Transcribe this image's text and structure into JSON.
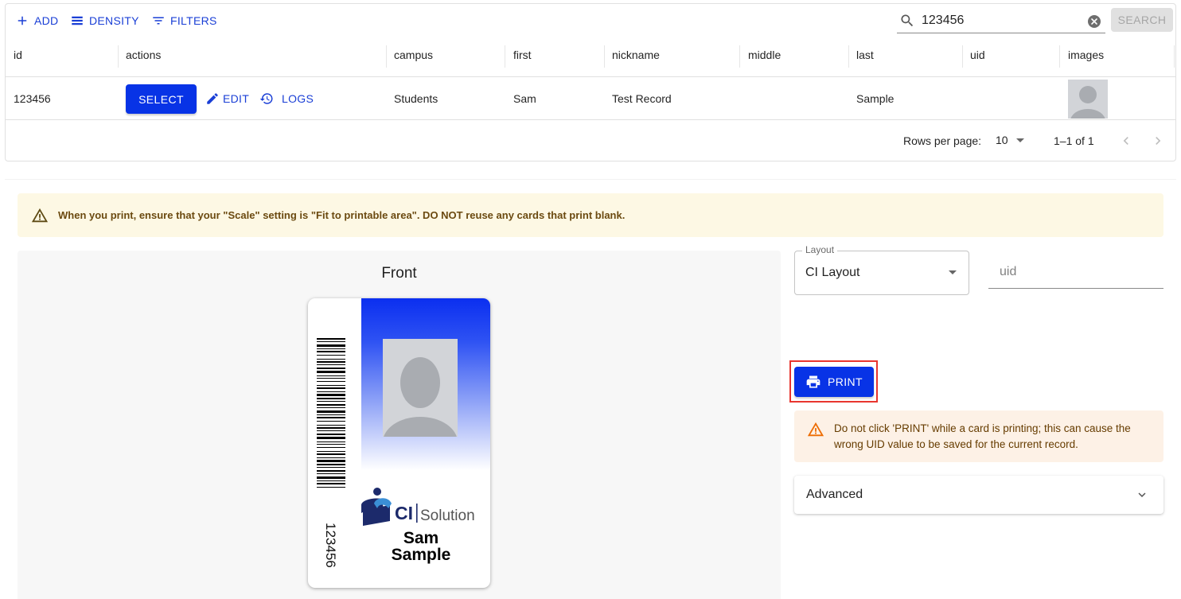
{
  "toolbar": {
    "add_label": "ADD",
    "density_label": "DENSITY",
    "filters_label": "FILTERS",
    "search_value": "123456",
    "search_button_label": "SEARCH"
  },
  "grid": {
    "columns": [
      "id",
      "actions",
      "campus",
      "first",
      "nickname",
      "middle",
      "last",
      "uid",
      "images"
    ],
    "rows": [
      {
        "id": "123456",
        "select_label": "SELECT",
        "edit_label": "EDIT",
        "logs_label": "LOGS",
        "campus": "Students",
        "first": "Sam",
        "nickname": "Test Record",
        "middle": "",
        "last": "Sample",
        "uid": ""
      }
    ],
    "pagination": {
      "rows_per_page_label": "Rows per page:",
      "rows_per_page_value": "10",
      "range_label": "1–1 of 1"
    }
  },
  "print_panel": {
    "info_alert": "When you print, ensure that your \"Scale\" setting is \"Fit to printable area\". DO NOT reuse any cards that print blank.",
    "preview_title": "Front",
    "card": {
      "id_text": "123456",
      "logo_text": "CI Solutions",
      "name_first": "Sam",
      "name_last": "Sample"
    },
    "layout_label": "Layout",
    "layout_value": "CI Layout",
    "uid_placeholder": "uid",
    "print_label": "PRINT",
    "warning_alert": "Do not click 'PRINT' while a card is printing; this can cause the wrong UID value to be saved for the current record.",
    "advanced_label": "Advanced"
  },
  "colors": {
    "primary": "#0833e6",
    "link": "#1a3fd6",
    "info_bg": "#fdf8e4",
    "warning_bg": "#fdf1e6",
    "highlight": "#e8352f"
  }
}
